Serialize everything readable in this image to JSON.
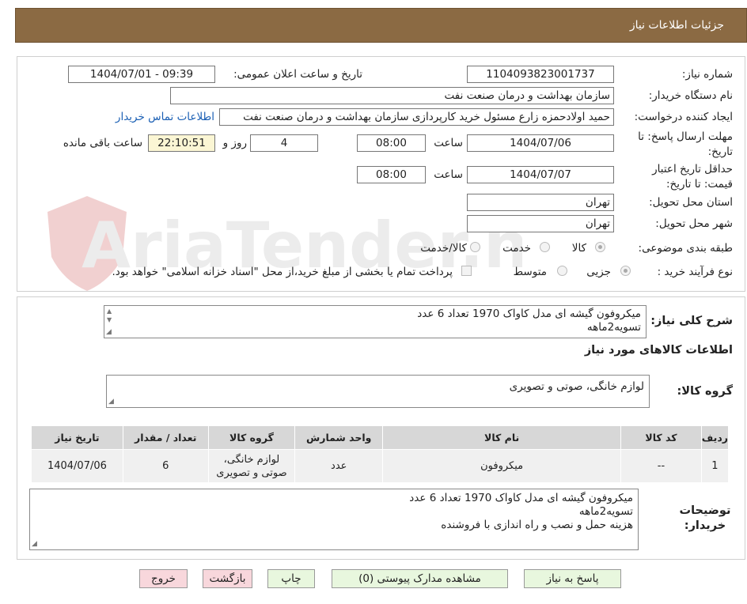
{
  "header": {
    "title": "جزئیات اطلاعات نیاز"
  },
  "watermark": {
    "text": "AriaTender.neT"
  },
  "form": {
    "need_number_label": "شماره نیاز:",
    "need_number": "1104093823001737",
    "announce_label": "تاریخ و ساعت اعلان عمومی:",
    "announce_value": "1404/07/01 - 09:39",
    "buyer_org_label": "نام دستگاه خریدار:",
    "buyer_org": "سازمان بهداشت و درمان صنعت نفت",
    "requester_label": "ایجاد کننده درخواست:",
    "requester": "حمید اولادحمزه زارع مسئول خرید کارپردازی سازمان بهداشت و درمان صنعت نفت",
    "contact_link": "اطلاعات تماس خریدار",
    "deadline_label": "مهلت ارسال پاسخ: تا تاریخ:",
    "deadline_date": "1404/07/06",
    "time_label": "ساعت",
    "deadline_time": "08:00",
    "days_value": "4",
    "days_label": "روز و",
    "remaining_time": "22:10:51",
    "remaining_label": "ساعت باقی مانده",
    "validity_label": "حداقل تاریخ اعتبار قیمت: تا تاریخ:",
    "validity_date": "1404/07/07",
    "validity_time": "08:00",
    "province_label": "استان محل تحویل:",
    "province": "تهران",
    "city_label": "شهر محل تحویل:",
    "city": "تهران",
    "category_label": "طبقه بندی موضوعی:",
    "category_options": [
      "کالا",
      "خدمت",
      "کالا/خدمت"
    ],
    "category_selected": "کالا",
    "process_label": "نوع فرآیند خرید :",
    "process_options": [
      "جزیی",
      "متوسط"
    ],
    "process_selected": "جزیی",
    "payment_note": "پرداخت تمام یا بخشی از مبلغ خرید،از محل \"اسناد خزانه اسلامی\" خواهد بود."
  },
  "summary": {
    "label": "شرح کلی نیاز:",
    "lines": [
      "میکروفون گیشه ای مدل کاواک 1970 تعداد 6 عدد",
      "تسویه2ماهه"
    ],
    "goods_info_title": "اطلاعات کالاهای مورد نیاز",
    "goods_group_label": "گروه کالا:",
    "goods_group": "لوازم خانگی، صوتی و تصویری"
  },
  "table": {
    "headers": [
      "ردیف",
      "کد کالا",
      "نام کالا",
      "واحد شمارش",
      "گروه کالا",
      "تعداد / مقدار",
      "تاریخ نیاز"
    ],
    "rows": [
      [
        "1",
        "--",
        "میکروفون",
        "عدد",
        "لوازم خانگی، صوتی و تصویری",
        "6",
        "1404/07/06"
      ]
    ]
  },
  "buyer_notes": {
    "label": "توضیحات خریدار:",
    "lines": [
      "میکروفون گیشه ای مدل کاواک 1970 تعداد 6 عدد",
      "تسویه2ماهه",
      "هزینه حمل و نصب و راه اندازی با فروشنده"
    ]
  },
  "buttons": {
    "reply": "پاسخ به نیاز",
    "attachments": "مشاهده مدارک پیوستی (0)",
    "print": "چاپ",
    "back": "بازگشت",
    "exit": "خروج"
  },
  "colors": {
    "header_bg": "#8b6a43",
    "button_green": "#e8f7de",
    "button_pink": "#f8d7dc",
    "remaining_bg": "#fbf6d4",
    "link": "#1a5fb4"
  }
}
